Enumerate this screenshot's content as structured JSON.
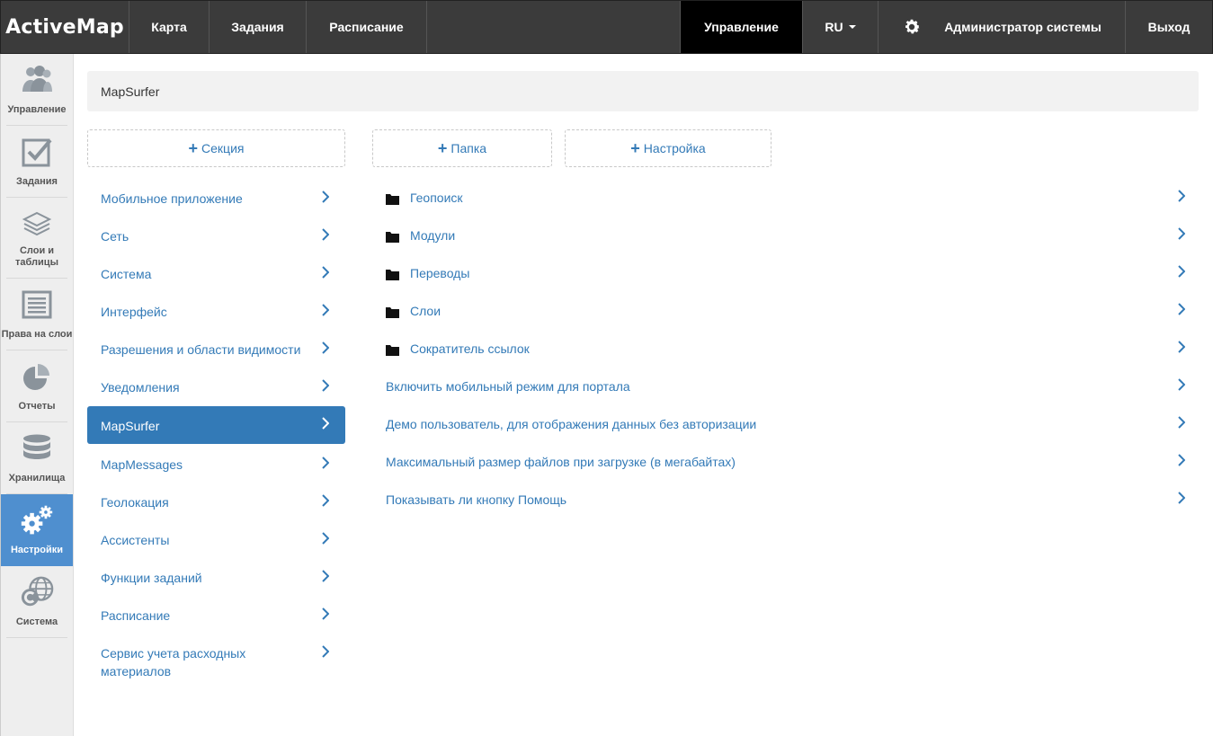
{
  "brand": "ActiveMap",
  "topnav": {
    "items": [
      "Карта",
      "Задания",
      "Расписание"
    ],
    "manage": "Управление",
    "lang": "RU",
    "user": "Администратор системы",
    "logout": "Выход"
  },
  "sidebar": {
    "items": [
      {
        "label": "Управление",
        "icon": "users-icon"
      },
      {
        "label": "Задания",
        "icon": "checkbox-icon"
      },
      {
        "label": "Слои и таблицы",
        "icon": "layers-icon"
      },
      {
        "label": "Права на слои",
        "icon": "list-icon"
      },
      {
        "label": "Отчеты",
        "icon": "pie-chart-icon"
      },
      {
        "label": "Хранилища",
        "icon": "database-icon"
      },
      {
        "label": "Настройки",
        "icon": "gears-icon"
      },
      {
        "label": "Система",
        "icon": "globe-icon"
      }
    ],
    "active": "Настройки"
  },
  "breadcrumb": "MapSurfer",
  "buttons": {
    "section": "Секция",
    "folder": "Папка",
    "setting": "Настройка"
  },
  "sections": [
    "Мобильное приложение",
    "Сеть",
    "Система",
    "Интерфейс",
    "Разрешения и области видимости",
    "Уведомления",
    "MapSurfer",
    "MapMessages",
    "Геолокация",
    "Ассистенты",
    "Функции заданий",
    "Расписание",
    "Сервис учета расходных материалов"
  ],
  "active_section": "MapSurfer",
  "folders": [
    "Геопоиск",
    "Модули",
    "Переводы",
    "Слои",
    "Сократитель ссылок"
  ],
  "settings": [
    "Включить мобильный режим для портала",
    "Демо пользователь, для отображения данных без авторизации",
    "Максимальный размер файлов при загрузке (в мегабайтах)",
    "Показывать ли кнопку Помощь"
  ],
  "colors": {
    "topbar": "#3b3b3b",
    "accent": "#337ab7",
    "sidebar_active": "#4f8fcf",
    "sidebar_bg": "#eeeeee"
  }
}
